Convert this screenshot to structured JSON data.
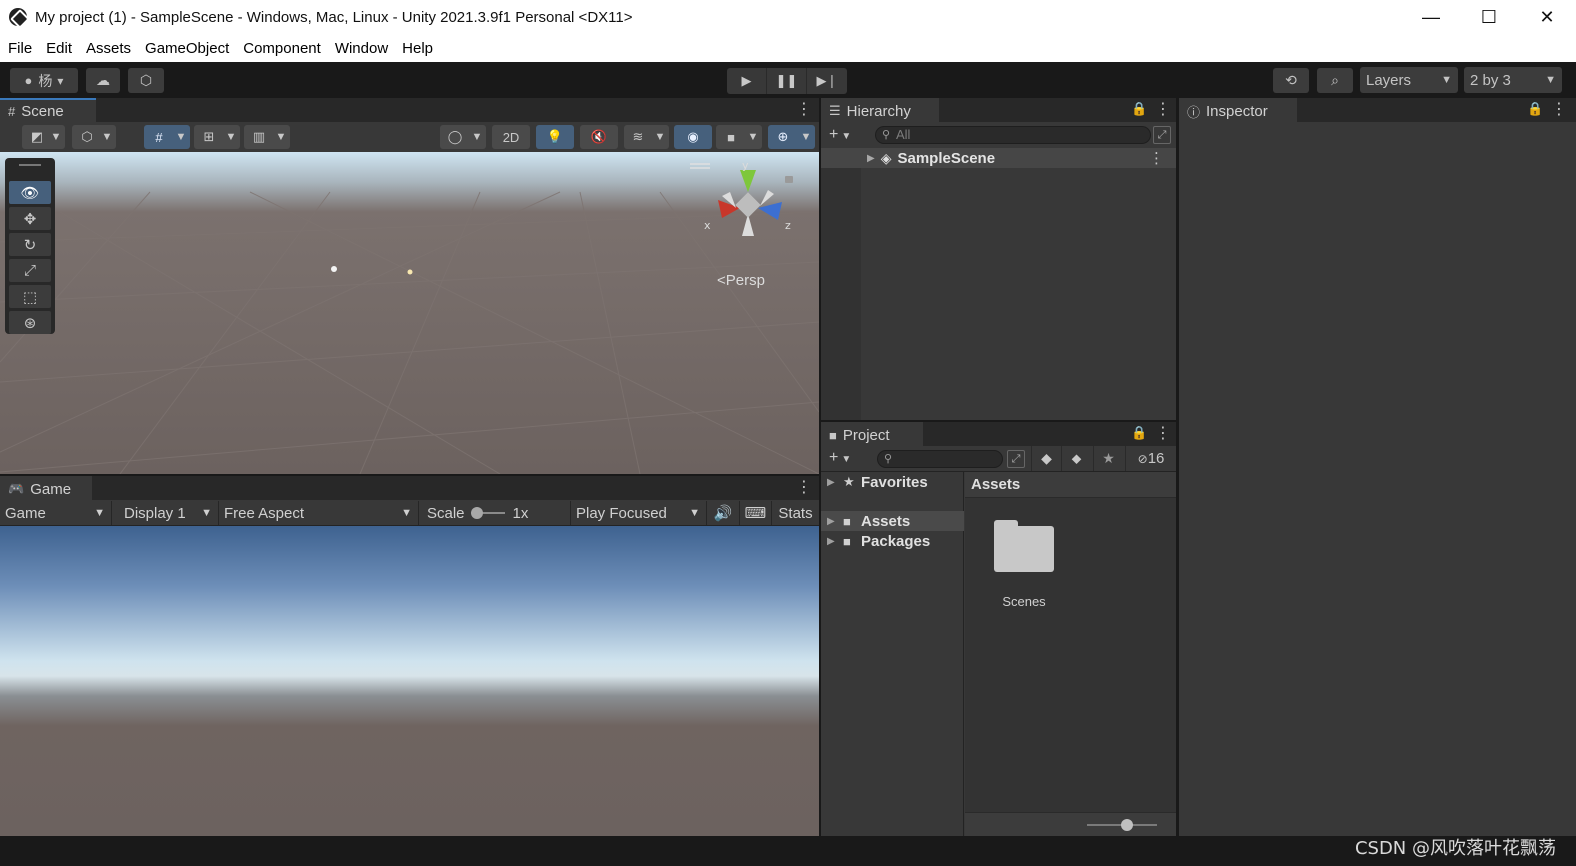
{
  "window": {
    "title": "My project (1) - SampleScene - Windows, Mac, Linux - Unity 2021.3.9f1 Personal <DX11>",
    "minimize": "—",
    "maximize": "☐",
    "close": "✕"
  },
  "menu": [
    "File",
    "Edit",
    "Assets",
    "GameObject",
    "Component",
    "Window",
    "Help"
  ],
  "toolbar": {
    "account_label": "杨",
    "layers_label": "Layers",
    "layout_label": "2 by 3"
  },
  "scene": {
    "tab_label": "Scene",
    "mode_2d_label": "2D",
    "persp_label": "<Persp",
    "gizmo_axes": {
      "x": "x",
      "y": "y",
      "z": "z"
    }
  },
  "game": {
    "tab_label": "Game",
    "view_select": "Game",
    "display_select": "Display 1",
    "aspect_select": "Free Aspect",
    "scale_label": "Scale",
    "scale_value": "1x",
    "play_mode_select": "Play Focused",
    "stats_label": "Stats"
  },
  "hierarchy": {
    "tab_label": "Hierarchy",
    "search_placeholder": "All",
    "items": [
      {
        "label": "SampleScene"
      }
    ]
  },
  "project": {
    "tab_label": "Project",
    "hidden_count": "16",
    "tree": {
      "favorites": "Favorites",
      "assets": "Assets",
      "packages": "Packages"
    },
    "breadcrumb": "Assets",
    "folders": [
      {
        "label": "Scenes"
      }
    ]
  },
  "inspector": {
    "tab_label": "Inspector"
  },
  "watermark": "CSDN @风吹落叶花飘荡",
  "colors": {
    "accent": "#3a79bb",
    "active_tool": "#46607c",
    "panel": "#383838",
    "chrome": "#191919"
  }
}
